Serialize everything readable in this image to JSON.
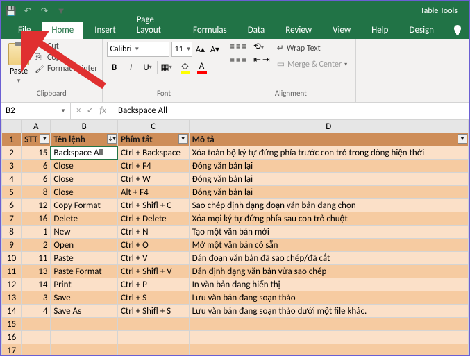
{
  "titlebar": {
    "table_tools": "Table Tools"
  },
  "tabs": {
    "file": "File",
    "home": "Home",
    "insert": "Insert",
    "page_layout": "Page Layout",
    "formulas": "Formulas",
    "data": "Data",
    "review": "Review",
    "view": "View",
    "help": "Help",
    "design": "Design"
  },
  "ribbon": {
    "clipboard": {
      "label": "Clipboard",
      "paste": "Paste",
      "cut": "Cut",
      "copy": "Copy",
      "format_painter": "Format Painter"
    },
    "font": {
      "label": "Font",
      "name": "Calibri",
      "size": "11"
    },
    "alignment": {
      "label": "Alignment",
      "wrap": "Wrap Text",
      "merge": "Merge & Center"
    }
  },
  "namebox": "B2",
  "formula": "Backspace All",
  "columns": [
    "A",
    "B",
    "C",
    "D"
  ],
  "header_row": {
    "stt": "STT",
    "ten_lenh": "Tên lệnh",
    "phim_tat": "Phím tắt",
    "mo_ta": "Mô tả"
  },
  "rows": [
    {
      "n": 2,
      "stt": "15",
      "ten": "Backspace All",
      "phim": "Ctrl + Backspace",
      "mota": "Xóa toàn bộ ký tự đứng phía trước con trỏ trong dòng hiện thời"
    },
    {
      "n": 3,
      "stt": "6",
      "ten": "Close",
      "phim": "Ctrl + F4",
      "mota": "Đóng văn bản lại"
    },
    {
      "n": 4,
      "stt": "6",
      "ten": "Close",
      "phim": "Ctrl + W",
      "mota": "Đóng văn bản lại"
    },
    {
      "n": 5,
      "stt": "8",
      "ten": "Close",
      "phim": "Alt + F4",
      "mota": "Đóng văn bản lại"
    },
    {
      "n": 6,
      "stt": "12",
      "ten": "Copy Format",
      "phim": "Ctrl + Shifl + C",
      "mota": "Sao chép định dạng đoạn văn bản đang chọn"
    },
    {
      "n": 7,
      "stt": "16",
      "ten": "Delete",
      "phim": "Ctrl + Delete",
      "mota": "Xóa mọi ký tự đứng phía sau con trỏ chuột"
    },
    {
      "n": 8,
      "stt": "1",
      "ten": "New",
      "phim": "Ctrl + N",
      "mota": "Tạo một văn bản mới"
    },
    {
      "n": 9,
      "stt": "2",
      "ten": "Open",
      "phim": "Ctrl + O",
      "mota": "Mở một văn bản có sẵn"
    },
    {
      "n": 10,
      "stt": "11",
      "ten": "Paste",
      "phim": "Ctrl + V",
      "mota": "Dán đoạn văn bản đã sao chép/đã cắt"
    },
    {
      "n": 11,
      "stt": "13",
      "ten": "Paste Format",
      "phim": "Ctrl + Shifl + V",
      "mota": "Dán định dạng văn bản vừa sao chép"
    },
    {
      "n": 12,
      "stt": "14",
      "ten": "Print",
      "phim": "Ctrl + P",
      "mota": "In văn bản đang hiển thị"
    },
    {
      "n": 13,
      "stt": "3",
      "ten": "Save",
      "phim": "Ctrl + S",
      "mota": "Lưu văn bản đang soạn thảo"
    },
    {
      "n": 14,
      "stt": "4",
      "ten": "Save As",
      "phim": "Ctrl + Shifl + S",
      "mota": "Lưu văn bản đang soạn thảo dưới một file khác."
    }
  ],
  "row_labels": [
    "1",
    "2",
    "3",
    "4",
    "5",
    "6",
    "7",
    "8",
    "9",
    "10",
    "11",
    "12",
    "13",
    "14",
    "15",
    "16",
    "17"
  ]
}
